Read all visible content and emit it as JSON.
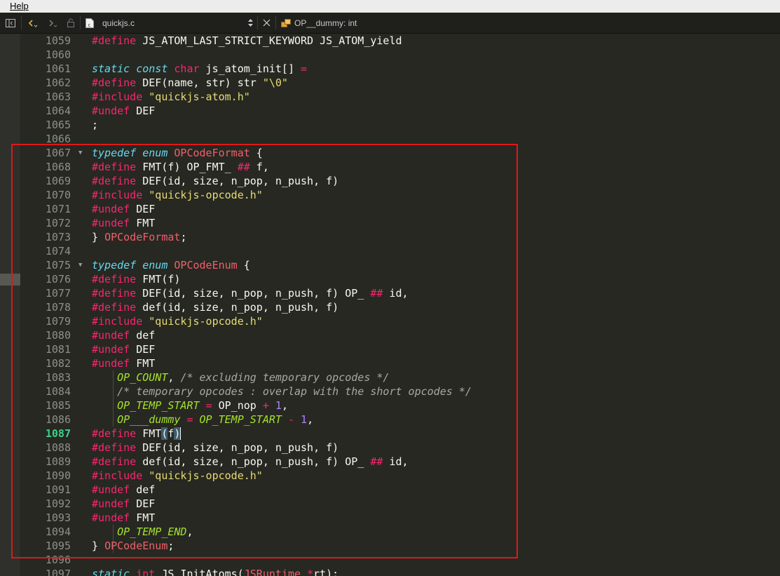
{
  "menu": {
    "help": "Help"
  },
  "toolbar": {
    "file_name": "quickjs.c",
    "symbol": "OP__dummy: int"
  },
  "code": {
    "current_line": "1087",
    "lines": [
      {
        "n": "1059",
        "t": "#define JS_ATOM_LAST_STRICT_KEYWORD JS_ATOM_yield"
      },
      {
        "n": "1060",
        "t": ""
      },
      {
        "n": "1061",
        "t": "static const char js_atom_init[] ="
      },
      {
        "n": "1062",
        "t": "#define DEF(name, str) str \"\\0\""
      },
      {
        "n": "1063",
        "t": "#include \"quickjs-atom.h\""
      },
      {
        "n": "1064",
        "t": "#undef DEF"
      },
      {
        "n": "1065",
        "t": ";"
      },
      {
        "n": "1066",
        "t": ""
      },
      {
        "n": "1067",
        "t": "typedef enum OPCodeFormat {",
        "fold": true
      },
      {
        "n": "1068",
        "t": "#define FMT(f) OP_FMT_ ## f,"
      },
      {
        "n": "1069",
        "t": "#define DEF(id, size, n_pop, n_push, f)"
      },
      {
        "n": "1070",
        "t": "#include \"quickjs-opcode.h\""
      },
      {
        "n": "1071",
        "t": "#undef DEF"
      },
      {
        "n": "1072",
        "t": "#undef FMT"
      },
      {
        "n": "1073",
        "t": "} OPCodeFormat;"
      },
      {
        "n": "1074",
        "t": ""
      },
      {
        "n": "1075",
        "t": "typedef enum OPCodeEnum {",
        "fold": true
      },
      {
        "n": "1076",
        "t": "#define FMT(f)"
      },
      {
        "n": "1077",
        "t": "#define DEF(id, size, n_pop, n_push, f) OP_ ## id,"
      },
      {
        "n": "1078",
        "t": "#define def(id, size, n_pop, n_push, f)"
      },
      {
        "n": "1079",
        "t": "#include \"quickjs-opcode.h\""
      },
      {
        "n": "1080",
        "t": "#undef def"
      },
      {
        "n": "1081",
        "t": "#undef DEF"
      },
      {
        "n": "1082",
        "t": "#undef FMT"
      },
      {
        "n": "1083",
        "t": "    OP_COUNT, /* excluding temporary opcodes */"
      },
      {
        "n": "1084",
        "t": "    /* temporary opcodes : overlap with the short opcodes */"
      },
      {
        "n": "1085",
        "t": "    OP_TEMP_START = OP_nop + 1,"
      },
      {
        "n": "1086",
        "t": "    OP___dummy = OP_TEMP_START - 1,"
      },
      {
        "n": "1087",
        "t": "#define FMT(f)"
      },
      {
        "n": "1088",
        "t": "#define DEF(id, size, n_pop, n_push, f)"
      },
      {
        "n": "1089",
        "t": "#define def(id, size, n_pop, n_push, f) OP_ ## id,"
      },
      {
        "n": "1090",
        "t": "#include \"quickjs-opcode.h\""
      },
      {
        "n": "1091",
        "t": "#undef def"
      },
      {
        "n": "1092",
        "t": "#undef DEF"
      },
      {
        "n": "1093",
        "t": "#undef FMT"
      },
      {
        "n": "1094",
        "t": "    OP_TEMP_END,"
      },
      {
        "n": "1095",
        "t": "} OPCodeEnum;"
      },
      {
        "n": "1096",
        "t": ""
      },
      {
        "n": "1097",
        "t": "static int JS_InitAtoms(JSRuntime *rt);"
      }
    ]
  },
  "colors": {
    "background": "#272822",
    "preprocessor": "#f92672",
    "keyword": "#66d9ef",
    "string": "#e6db74",
    "enum_constant": "#a6e22e",
    "highlight_box": "#e01818"
  }
}
